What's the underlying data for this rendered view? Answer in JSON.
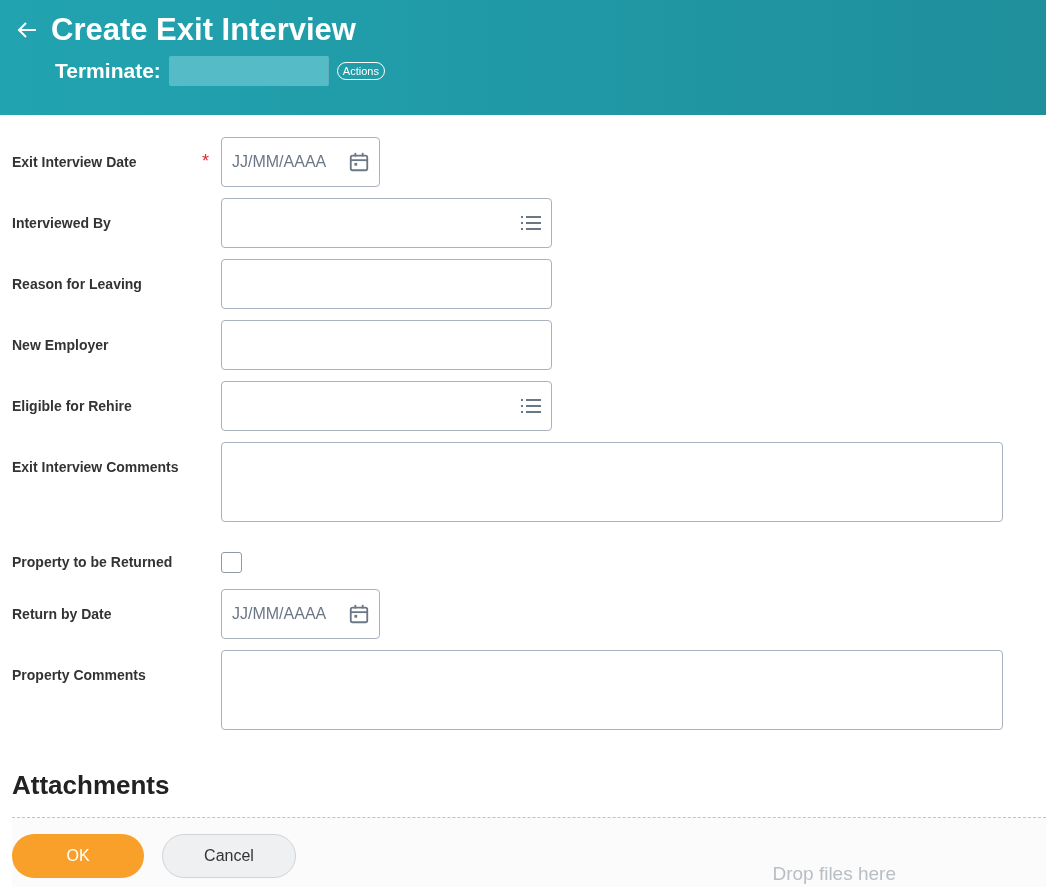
{
  "header": {
    "title": "Create Exit Interview",
    "subtitle_label": "Terminate:",
    "actions_button": "Actions"
  },
  "fields": [
    {
      "label": "Exit Interview Date",
      "kind": "date",
      "required_mark": "*",
      "placeholder": "JJ/MM/AAAA"
    },
    {
      "label": "Interviewed By",
      "kind": "prompt"
    },
    {
      "label": "Reason for Leaving",
      "kind": "text"
    },
    {
      "label": "New Employer",
      "kind": "text"
    },
    {
      "label": "Eligible for Rehire",
      "kind": "prompt"
    },
    {
      "label": "Exit Interview Comments",
      "kind": "textarea"
    },
    {
      "label": "Property to be Returned",
      "kind": "checkbox",
      "checked": false
    },
    {
      "label": "Return by Date",
      "kind": "date",
      "placeholder": "JJ/MM/AAAA"
    },
    {
      "label": "Property Comments",
      "kind": "textarea"
    }
  ],
  "attachments": {
    "title": "Attachments",
    "drop_text": "Drop files here"
  },
  "buttons": [
    {
      "label": "OK",
      "kind": "primary"
    },
    {
      "label": "Cancel",
      "kind": "secondary"
    }
  ]
}
